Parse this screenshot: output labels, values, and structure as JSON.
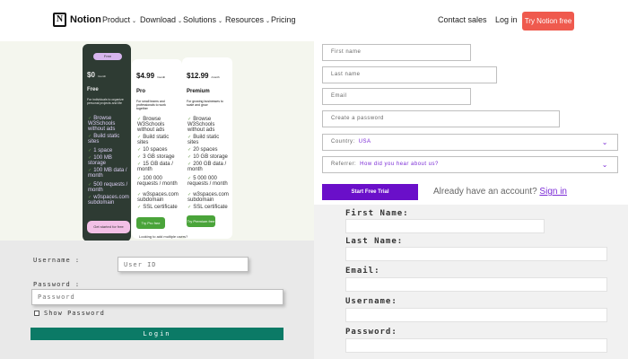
{
  "nav": {
    "logo_letter": "N",
    "logo_text": "Notion",
    "items": [
      "Product",
      "Download",
      "Solutions",
      "Resources",
      "Pricing"
    ],
    "contact": "Contact sales",
    "login": "Log in",
    "cta": "Try Notion free"
  },
  "pricing": {
    "free": {
      "badge": "Free",
      "price": "$0",
      "per": "/month",
      "plan": "Free",
      "desc": "For individuals to organize personal projects and life",
      "features": [
        "Browse W3Schools without ads",
        "Build static sites",
        "1 space",
        "100 MB storage",
        "100 MB data / month",
        "500 requests / month",
        "w3spaces.com subdomain"
      ],
      "button": "Get started for free"
    },
    "pro": {
      "price": "$4.99",
      "per": "/month",
      "plan": "Pro",
      "desc": "For small teams and professionals to work together",
      "features": [
        "Browse W3Schools without ads",
        "Build static sites",
        "10 spaces",
        "3 GB storage",
        "15 GB data / month",
        "100 000 requests / month",
        "w3spaces.com subdomain",
        "SSL certificate"
      ],
      "button": "Try Pro free",
      "note": "Looking to add multiple users?"
    },
    "premium": {
      "price": "$12.99",
      "per": "/month",
      "plan": "Premium",
      "desc": "For growing businesses to scale and grow",
      "features": [
        "Browse W3Schools without ads",
        "Build static sites",
        "20 spaces",
        "10 GB storage",
        "200 GB data / month",
        "5 000 000 requests / month",
        "w3spaces.com subdomain",
        "SSL certificate"
      ],
      "button": "Try Premium free"
    }
  },
  "login": {
    "username_label": "Username :",
    "username_placeholder": "User ID",
    "password_label": "Password :",
    "password_placeholder": "Password",
    "show_password": "Show Password",
    "login_button": "Login"
  },
  "signup": {
    "first_name": "First name",
    "last_name": "Last name",
    "email": "Email",
    "password": "Create a password",
    "country_label": "Country:",
    "country_value": "USA",
    "referrer_label": "Referrer:",
    "referrer_value": "How did you hear about us?",
    "trial_button": "Start Free Trial",
    "already": "Already have an account?",
    "signin": "Sign in"
  },
  "form2": {
    "labels": [
      "First Name:",
      "Last Name:",
      "Email:",
      "Username:",
      "Password:"
    ]
  }
}
